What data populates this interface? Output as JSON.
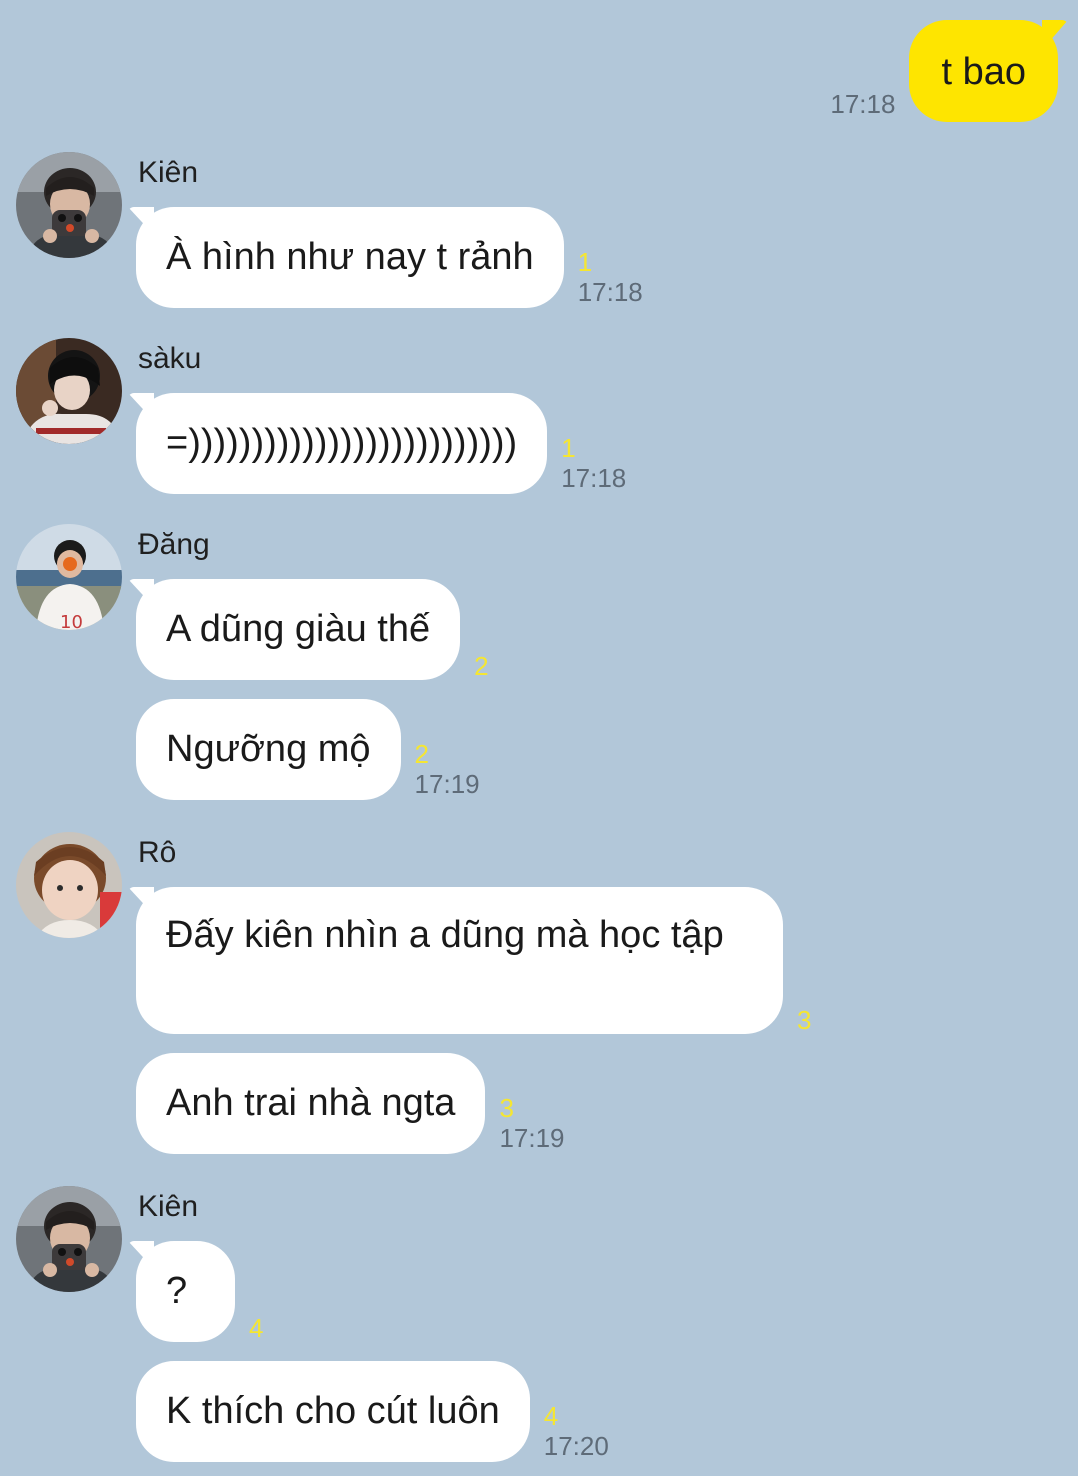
{
  "outgoing": {
    "text": "t bao",
    "time": "17:18"
  },
  "groups": [
    {
      "sender": "Kiên",
      "avatar_icon": "person-avatar",
      "messages": [
        {
          "text": "À hình như nay t rảnh",
          "unread": "1",
          "time": "17:18"
        }
      ]
    },
    {
      "sender": "sàku",
      "avatar_icon": "person-avatar",
      "messages": [
        {
          "text": "=))))))))))))))))))))))))))",
          "unread": "1",
          "time": "17:18"
        }
      ]
    },
    {
      "sender": "Đăng",
      "avatar_icon": "person-avatar",
      "messages": [
        {
          "text": "A dũng giàu thế",
          "unread": "2",
          "time": ""
        },
        {
          "text": "Ngưỡng mộ",
          "unread": "2",
          "time": "17:19"
        }
      ]
    },
    {
      "sender": "Rô",
      "avatar_icon": "person-avatar",
      "messages": [
        {
          "text": "Đấy kiên nhìn a dũng mà học tập",
          "unread": "3",
          "time": ""
        },
        {
          "text": "Anh trai nhà ngta",
          "unread": "3",
          "time": "17:19"
        }
      ]
    },
    {
      "sender": "Kiên",
      "avatar_icon": "person-avatar",
      "messages": [
        {
          "text": "?",
          "unread": "4",
          "time": ""
        },
        {
          "text": "K thích cho cút luôn",
          "unread": "4",
          "time": "17:20"
        }
      ]
    }
  ],
  "colors": {
    "background": "#b2c7d9",
    "outgoing_bubble": "#fee500",
    "incoming_bubble": "#ffffff",
    "unread_count": "#f5e632",
    "timestamp": "#5e6b78"
  }
}
